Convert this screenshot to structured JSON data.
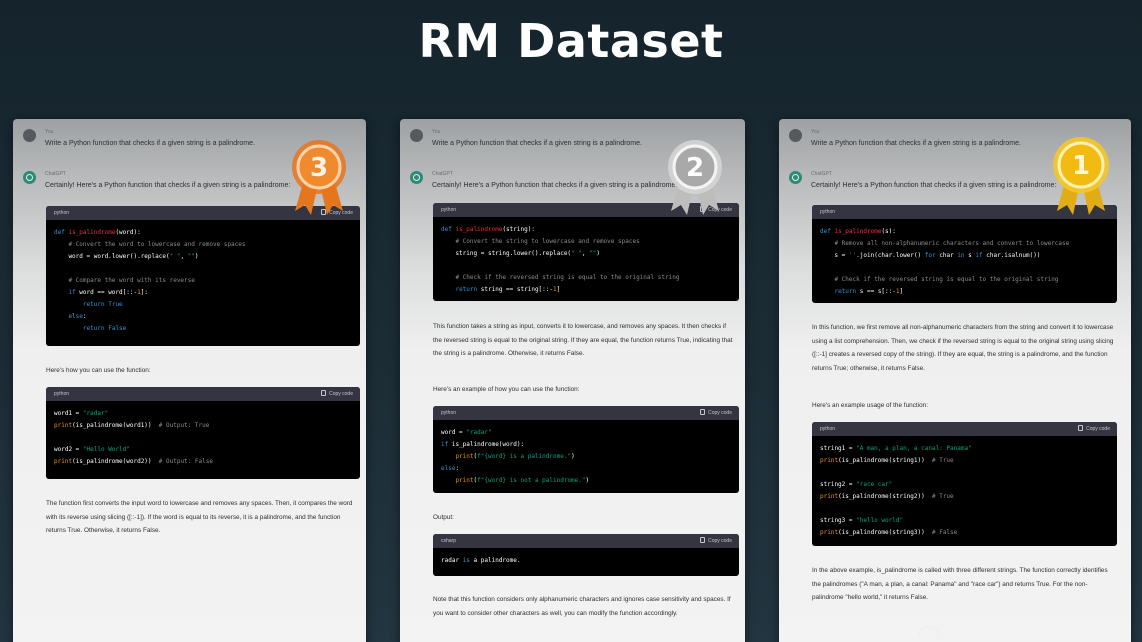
{
  "title": "RM Dataset",
  "prompt": "Write a Python function that checks if a given string is a palindrome.",
  "roles": {
    "user": "You",
    "assistant": "ChatGPT"
  },
  "copy_label": "Copy code",
  "colors": {
    "bronze": "#e8751f",
    "silver": "#d4d4d4",
    "gold": "#f5c72a",
    "background": "#1a2a33"
  },
  "cards": [
    {
      "rank": "3",
      "intro": "Certainly! Here's a Python function that checks if a given string is a palindrome:",
      "code1_lang": "python",
      "usage_intro": "Here's how you can use the function:",
      "code2_lang": "python",
      "explanation": "The function first converts the input word to lowercase and removes any spaces. Then, it compares the word with its reverse using slicing ([::-1]). If the word is equal to its reverse, it is a palindrome, and the function returns True. Otherwise, it returns False."
    },
    {
      "rank": "2",
      "intro": "Certainly! Here's a Python function that checks if a given string is a palindrome:",
      "code1_lang": "python",
      "explanation": "This function takes a string as input, converts it to lowercase, and removes any spaces. It then checks if the reversed string is equal to the original string. If they are equal, the function returns True, indicating that the string is a palindrome. Otherwise, it returns False.",
      "usage_intro": "Here's an example of how you can use the function:",
      "code2_lang": "python",
      "output_label": "Output:",
      "code3_lang": "csharp",
      "note": "Note that this function considers only alphanumeric characters and ignores case sensitivity and spaces. If you want to consider other characters as well, you can modify the function accordingly."
    },
    {
      "rank": "1",
      "intro": "Certainly! Here's a Python function that checks if a given string is a palindrome:",
      "code1_lang": "python",
      "explanation": "In this function, we first remove all non-alphanumeric characters from the string and convert it to lowercase using a list comprehension. Then, we check if the reversed string is equal to the original string using slicing ([::-1] creates a reversed copy of the string). If they are equal, the string is a palindrome, and the function returns True; otherwise, it returns False.",
      "usage_intro": "Here's an example usage of the function:",
      "code2_lang": "python",
      "conclusion": "In the above example, is_palindrome is called with three different strings. The function correctly identifies the palindromes (\"A man, a plan, a canal: Panama\" and \"race car\") and returns True. For the non-palindrome \"hello world,\" it returns False."
    }
  ]
}
